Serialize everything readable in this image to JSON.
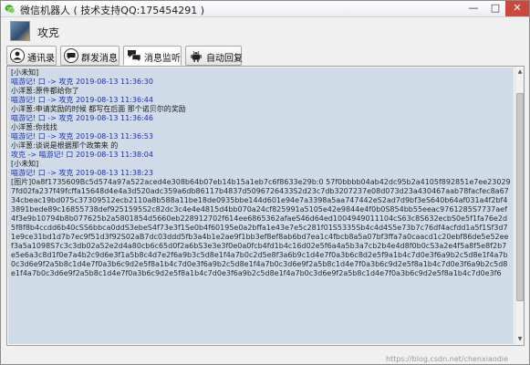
{
  "window": {
    "title": "微信机器人 ( 技术支持QQ:175454291 )",
    "minimize": "—",
    "maximize": "□",
    "close": "✕",
    "icon": "wechat-icon"
  },
  "contact": {
    "name": "攻克",
    "avatar": "avatar"
  },
  "tabs": [
    {
      "label": "通讯录",
      "icon": "contacts-icon"
    },
    {
      "label": "群发消息",
      "icon": "chat-bubble-icon"
    },
    {
      "label": "消息监听",
      "icon": "chat-bubbles-icon",
      "active": true
    },
    {
      "label": "自动回复",
      "icon": "android-icon"
    }
  ],
  "log": {
    "lines": [
      {
        "type": "msg",
        "text": "[小未知]"
      },
      {
        "type": "hdr",
        "text": "喵游记! 口 -> 攻克   2019-08-13 11:36:30"
      },
      {
        "type": "msg",
        "text": "小洋葱:原件都给你了"
      },
      {
        "type": "hdr",
        "text": "喵游记! 口 -> 攻克   2019-08-13 11:36:44"
      },
      {
        "type": "msg",
        "text": "小洋葱:申请奖励的时候   都写在后面     那个诺贝尔的奖励"
      },
      {
        "type": "hdr",
        "text": "喵游记! 口 -> 攻克   2019-08-13 11:36:46"
      },
      {
        "type": "msg",
        "text": "小洋葱:你找找"
      },
      {
        "type": "hdr",
        "text": "喵游记! 口 -> 攻克   2019-08-13 11:36:53"
      },
      {
        "type": "msg",
        "text": "小洋葱:谈说是根据那个政策来 的"
      },
      {
        "type": "hdr",
        "text": "攻克 -> 喵游记! 口   2019-08-13 11:38:04"
      },
      {
        "type": "msg",
        "text": "[小未知]"
      },
      {
        "type": "hdr",
        "text": "喵游记! 口 -> 攻克   2019-08-13 11:38:23"
      }
    ],
    "hex_block": "[图片]0a8f1735609Bc5d574a97a522aced4e308b64b07eb14b15a1eb7c6f8633e29b:0 57f0bbbb04ab42dc95b2a4105f892851e7ee230297fd02fa237f49fcffa15648d4e4a3d520adc359a6db86117b4837d5096726433S2d23c7db3207237e08d073d23a430467aab78facfec8a6734cbeac19bd075c37309512ecb2110a8b588a11be18de0935bbe144d601e94e7a3398a5aa747442eS2ad7d9bf3eS640b64af031a4f2bf43891bede89c16855738def9251595S2c82dc3c4e4e4815d4bb070a24cf825991a5105e42e9844e4f0b0S854bb55eeac9761285S7737aef4f3e9b10794b8b077625b2a5801854d5660eb228912702f614ee6865362afaeS46d64ed1004949011104cS63c8S632ecbS0e5f1fa76e2d5f8f8b4ccdd6b40cSS6bbca0ddS3ebeS4f73e3f1Se0b4f60195e0a2bffa1e43e7e5c281f01S5335Sb4c4d4S5e73b7c76df4acfdd1a5f1Sf3d71e9ce31bd1d7b7ec9f51d3f92S02aB7dc03ddd5fb3a4b1e2ae9f1bb3ef8ef8ab6bd7ea1c4fbcb8a5a07bf3ffa7a0caacd1c20ebf86de5e52eef3a5a1098S7c3c3db02a52e2d4a80cb6c65d0f2a6bS3e3e3f0e0a0fcb4fd1b4c16d02e5f6a4a5b3a7cb2b4e4d8f0b0cS3a2e4f5a8f5e8f2b7e5e6a3c8d1f0e7a4b2c9d6e3f1a5b8c4d7e2f6a9b3c5d8e1f4a7b0c2d5e8f3a6b9c1d4e7f0a3b6c8d2e5f9a1b4c7d0e3f6a9b2c5d8e1f4a7b0c3d6e9f2a5b8c1d4e7f0a3b6c9d2e5f8a1b4c7d0e3f6a9b2c5d8e1f4a7b0c3d6e9f2a5b8c1d4e7f0a3b6c9d2e5f8a1b4c7d0e3f6a9b2c5d8e1f4a7b0c3d6e9f2a5b8c1d4e7f0a3b6c9d2e5f8a1b4c7d0e3f6a9b2c5d8e1f4a7b0c3d6e9f2a5b8c1d4e7f0a3b6c9d2e5f8a1b4c7d0e3f6"
  },
  "watermark": "https://blog.csdn.net/chenxiaodie"
}
